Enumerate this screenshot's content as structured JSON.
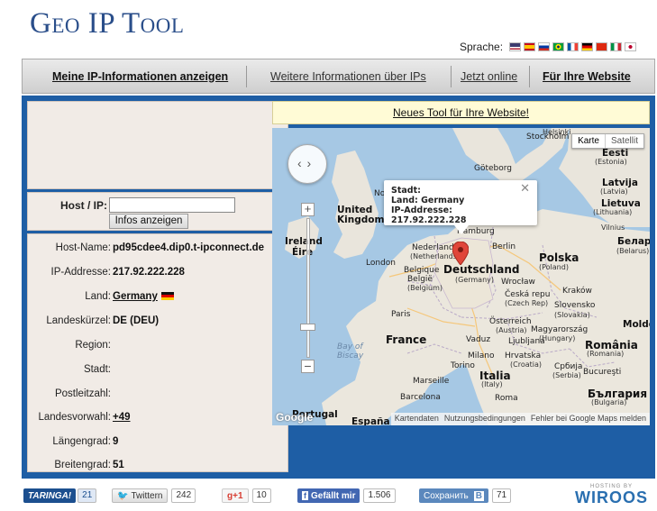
{
  "header": {
    "logo": "Geo IP Tool",
    "language_label": "Sprache:",
    "flags": [
      "flag-us",
      "flag-es",
      "flag-ru",
      "flag-br",
      "flag-fr",
      "flag-de",
      "flag-cn",
      "flag-it",
      "flag-jp"
    ]
  },
  "nav": {
    "item1": "Meine IP-Informationen anzeigen",
    "item2": "Weitere Informationen über IPs",
    "item3": "Jetzt online",
    "item4": "Für Ihre Website"
  },
  "host_form": {
    "label": "Host / IP:",
    "input_value": "",
    "button": "Infos anzeigen"
  },
  "info": [
    {
      "key": "Host-Name:",
      "value": "pd95cdee4.dip0.t-ipconnect.de"
    },
    {
      "key": "IP-Addresse:",
      "value": "217.92.222.228"
    },
    {
      "key": "Land:",
      "value": "Germany",
      "link": true,
      "flag": "flag-de"
    },
    {
      "key": "Landeskürzel:",
      "value": "DE (DEU)"
    },
    {
      "key": "Region:",
      "value": ""
    },
    {
      "key": "Stadt:",
      "value": ""
    },
    {
      "key": "Postleitzahl:",
      "value": ""
    },
    {
      "key": "Landesvorwahl:",
      "value": "+49",
      "link": true
    },
    {
      "key": "Längengrad:",
      "value": "9"
    },
    {
      "key": "Breitengrad:",
      "value": "51"
    }
  ],
  "banner": "Neues Tool für Ihre Website!",
  "map": {
    "toggle_map": "Karte",
    "toggle_sat": "Satellit",
    "popup": {
      "city": "Stadt:",
      "country": "Land: Germany",
      "ip": "IP-Addresse: 217.92.222.228"
    },
    "google": "Google",
    "attribution": [
      "Kartendaten",
      "Nutzungsbedingungen",
      "Fehler bei Google Maps melden"
    ],
    "labels": {
      "helsinki": "Helsinki",
      "stockholm": "Stockholm",
      "eesti": "Eesti",
      "estonia": "(Estonia)",
      "goteborg": "Göteborg",
      "latvija": "Latvija",
      "latvia": "(Latvia)",
      "lietuva": "Lietuva",
      "lithuania": "(Lithuania)",
      "vilnius": "Vilnius",
      "united_kingdom": "United Kingdom",
      "no": "No",
      "ireland": "Ireland",
      "eire": "Éire",
      "london": "London",
      "nederland": "Nederland",
      "netherlands": "(Netherlands)",
      "hamburg": "Hamburg",
      "berlin": "Berlin",
      "belarus": "Беларусь",
      "belarus_en": "(Belarus)",
      "belgique": "Belgique",
      "belgie": "België",
      "belgium": "(Belgium)",
      "deutschland": "Deutschland",
      "germany": "(Germany)",
      "polska": "Polska",
      "poland": "(Poland)",
      "wroclaw": "Wrocław",
      "krakow": "Kraków",
      "ceska": "Česká repu",
      "czech": "(Czech Rep)",
      "slovensko": "Slovensko",
      "slovakia": "(Slovakia)",
      "paris": "Paris",
      "osterreich": "Österreich",
      "austria": "(Austria)",
      "magyarorszag": "Magyarország",
      "hungary": "(Hungary)",
      "moldova": "Moldo",
      "france": "France",
      "vaduz": "Vaduz",
      "ljubljana": "Ljubljana",
      "bay_of_biscay": "Bay of Biscay",
      "milano": "Milano",
      "hrvatska": "Hrvatska",
      "croatia": "(Croatia)",
      "romania": "România",
      "romania_en": "(Romania)",
      "torino": "Torino",
      "srbija": "Србија",
      "serbia": "(Serbia)",
      "bucuresti": "Bucureşti",
      "marseille": "Marseille",
      "italia": "Italia",
      "italy": "(Italy)",
      "barcelona": "Barcelona",
      "roma": "Roma",
      "bulgaria": "България",
      "bulgaria_en": "(Bulgaria)",
      "portugal": "Portugal",
      "espana": "España"
    }
  },
  "footer": {
    "taringa": "TARINGA!",
    "taringa_count": "21",
    "twitter": "Twittern",
    "twitter_count": "242",
    "gplus": "g+1",
    "gplus_count": "10",
    "facebook": "Gefällt mir",
    "facebook_count": "1.506",
    "vk": "Сохранить",
    "vk_count": "71",
    "hosting": "HOSTING BY",
    "wiroos": "WIROOS"
  }
}
